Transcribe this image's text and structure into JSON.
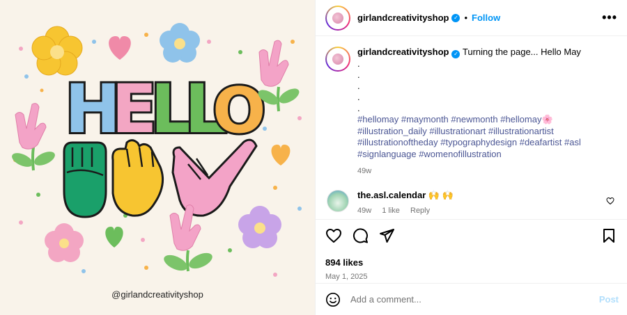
{
  "image": {
    "headline": "HELLO",
    "credit": "@girlandcreativityshop",
    "colors": {
      "background": "#f9f3ea",
      "letter_blue": "#8fc3ea",
      "letter_pink": "#f3a6c3",
      "letter_green": "#6cbd5c",
      "letter_orange": "#f7b24a",
      "hand_green": "#1aa06a",
      "hand_yellow": "#f7c531",
      "hand_pink": "#f3a3c7"
    }
  },
  "header": {
    "username": "girlandcreativityshop",
    "verified": true,
    "separator": "•",
    "follow_label": "Follow",
    "more_label": "•••"
  },
  "caption": {
    "username": "girlandcreativityshop",
    "text": "Turning the page... Hello May",
    "dots": [
      ".",
      ".",
      ".",
      ".",
      "."
    ],
    "hashtags_line1": "#hellomay #maymonth #newmonth #hellomay🌸",
    "hashtags_line2": "#illustration_daily #illustrationart #illustrationartist",
    "hashtags_line3": "#illustrationoftheday #typographydesign #deafartist #asl",
    "hashtags_line4": "#signlanguage #womenofillustration",
    "age": "49w"
  },
  "comment": {
    "username": "the.asl.calendar",
    "text": "🙌 🙌",
    "age": "49w",
    "likes": "1 like",
    "reply_label": "Reply"
  },
  "actions": {
    "icons": [
      "heart-icon",
      "comment-icon",
      "share-icon",
      "bookmark-icon"
    ]
  },
  "likes_text": "894 likes",
  "date_text": "May 1, 2025",
  "add_comment": {
    "placeholder": "Add a comment...",
    "post_label": "Post"
  }
}
